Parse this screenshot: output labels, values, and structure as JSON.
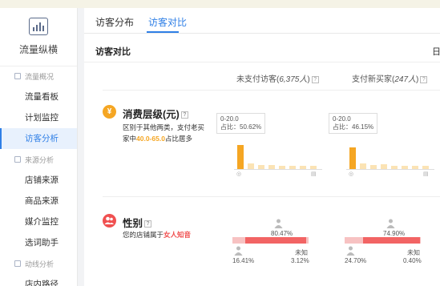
{
  "sidebar": {
    "title": "流量纵横",
    "groups": [
      {
        "label": "流量概况",
        "items": [
          "流量看板",
          "计划监控",
          "访客分析"
        ]
      },
      {
        "label": "来源分析",
        "items": [
          "店铺来源",
          "商品来源",
          "媒介监控",
          "选词助手"
        ]
      },
      {
        "label": "动线分析",
        "items": [
          "店内路径"
        ]
      }
    ],
    "active_item": "访客分析"
  },
  "tabs": [
    "访客分布",
    "访客对比"
  ],
  "active_tab": "访客对比",
  "section_title": "访客对比",
  "date_label": "日",
  "columns": [
    {
      "label": "未支付访客",
      "count": "6,375人"
    },
    {
      "label": "支付新买家",
      "count": "247人"
    }
  ],
  "consumption": {
    "title": "消费层级(元)",
    "icon": "yen-icon",
    "color": "#f5a623",
    "desc_prefix": "区别于其他两类，支付老买",
    "desc_mid": "家中",
    "desc_highlight": "40.0-65.0",
    "desc_suffix": "占比居多",
    "charts": [
      {
        "tip_range": "0-20.0",
        "tip_share": "占比：50.62%",
        "values": [
          50.62,
          12,
          9,
          8,
          6,
          4,
          3,
          2
        ]
      },
      {
        "tip_range": "0-20.0",
        "tip_share": "占比：46.15%",
        "values": [
          46.15,
          11,
          8,
          10,
          5,
          4,
          3,
          2
        ]
      }
    ]
  },
  "gender": {
    "title": "性别",
    "icon": "person-icon",
    "color": "#f05050",
    "desc_prefix": "您的店铺属于",
    "desc_highlight": "女人知音",
    "unknown_label": "未知",
    "charts": [
      {
        "female": "80.47%",
        "male": "16.41%",
        "unknown": "3.12%",
        "female_val": 80.47,
        "male_val": 16.41,
        "unknown_val": 3.12
      },
      {
        "female": "74.90%",
        "male": "24.70%",
        "unknown": "0.40%",
        "female_val": 74.9,
        "male_val": 24.7,
        "unknown_val": 0.4
      }
    ]
  }
}
